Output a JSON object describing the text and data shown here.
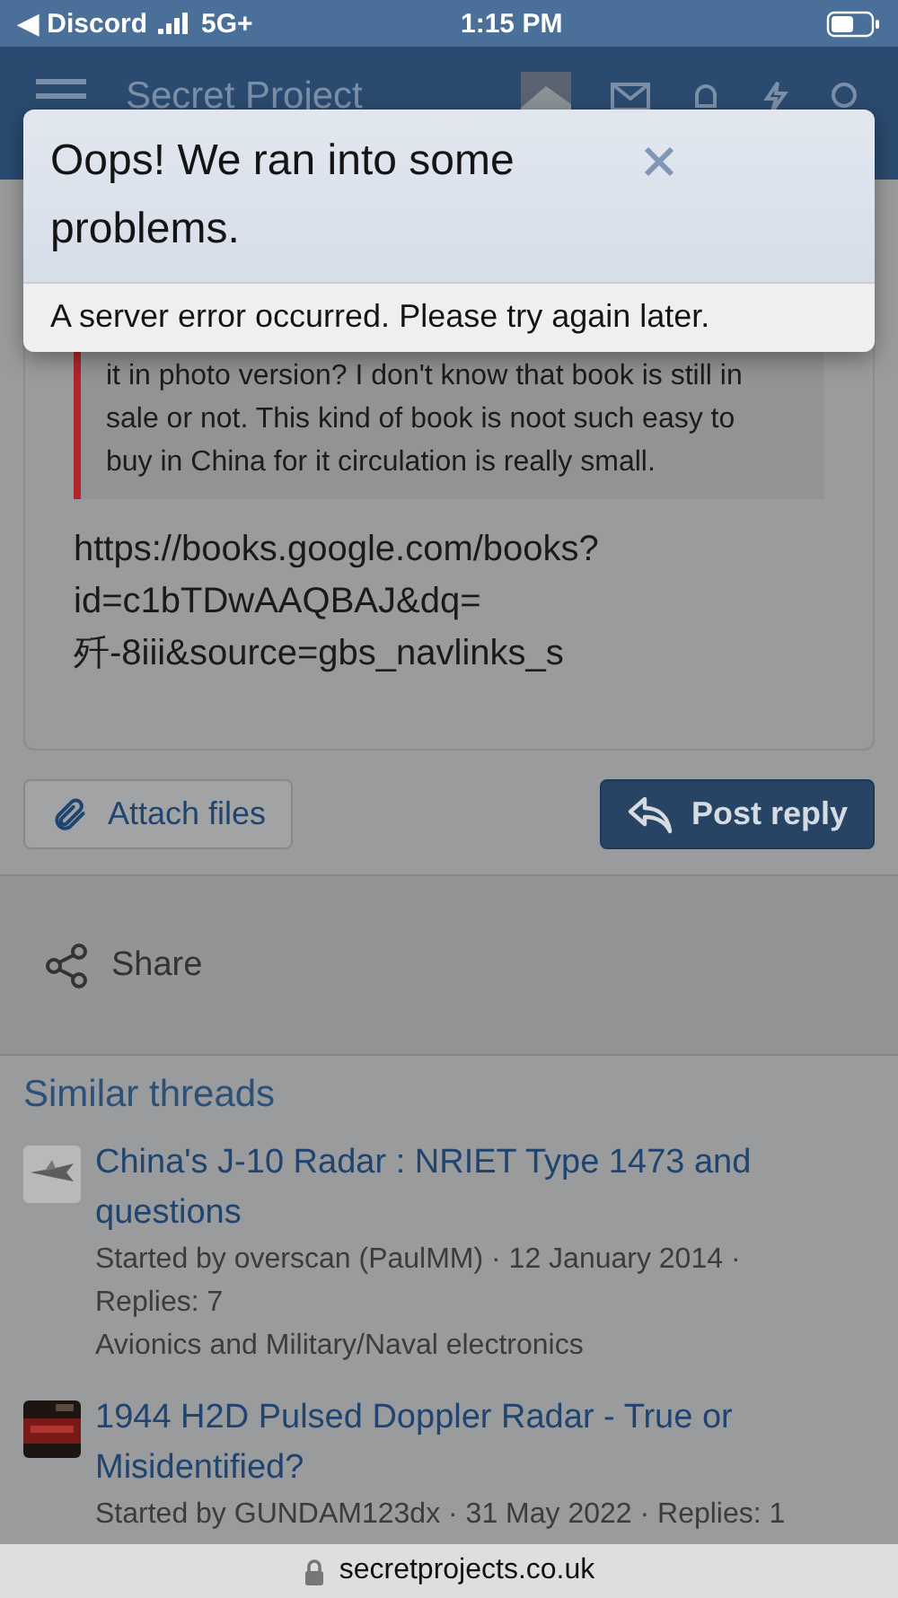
{
  "status_bar": {
    "back_app": "◀ Discord",
    "network": "5G+",
    "time": "1:15 PM"
  },
  "nav": {
    "title": "Secret Project"
  },
  "error_dialog": {
    "title": "Oops! We ran into some problems.",
    "message": "A server error occurred. Please try again later."
  },
  "post": {
    "quote": "it in photo version? I don't know that book is still in sale or not. This kind of book is noot such easy to buy in China for it circulation is really small.",
    "link_lines": [
      "https://books.google.com/books?",
      "id=c1bTDwAAQBAJ&dq=",
      "歼-8iii&source=gbs_navlinks_s"
    ]
  },
  "buttons": {
    "attach": "Attach files",
    "reply": "Post reply"
  },
  "share": "Share",
  "similar": {
    "heading": "Similar threads",
    "threads": [
      {
        "title": "China's J-10 Radar : NRIET Type 1473 and questions",
        "meta": "Started by overscan (PaulMM) · 12 January 2014 · Replies: 7",
        "forum": "Avionics and Military/Naval electronics"
      },
      {
        "title": "1944 H2D Pulsed Doppler Radar - True or Misidentified?",
        "meta": "Started by GUNDAM123dx · 31 May 2022 · Replies: 1"
      }
    ]
  },
  "url_bar": {
    "url": "secretprojects.co.uk"
  }
}
